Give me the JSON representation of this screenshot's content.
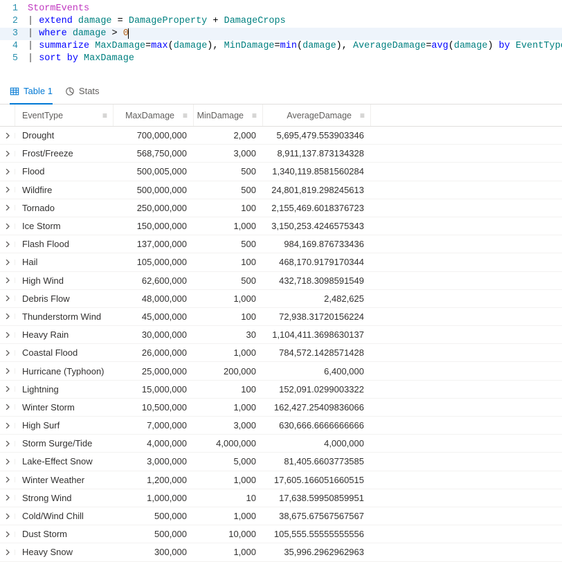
{
  "editor": {
    "lines": [
      {
        "n": "1",
        "active": false,
        "tokens": [
          {
            "cls": "tok-table",
            "t": "StormEvents"
          }
        ]
      },
      {
        "n": "2",
        "active": false,
        "tokens": [
          {
            "cls": "tok-pipe",
            "t": "| "
          },
          {
            "cls": "tok-keyword",
            "t": "extend"
          },
          {
            "cls": "",
            "t": " "
          },
          {
            "cls": "tok-ident",
            "t": "damage"
          },
          {
            "cls": "",
            "t": " "
          },
          {
            "cls": "tok-op",
            "t": "="
          },
          {
            "cls": "",
            "t": " "
          },
          {
            "cls": "tok-col",
            "t": "DamageProperty"
          },
          {
            "cls": "",
            "t": " "
          },
          {
            "cls": "tok-op",
            "t": "+"
          },
          {
            "cls": "",
            "t": " "
          },
          {
            "cls": "tok-col",
            "t": "DamageCrops"
          }
        ]
      },
      {
        "n": "3",
        "active": true,
        "tokens": [
          {
            "cls": "tok-pipe",
            "t": "| "
          },
          {
            "cls": "tok-keyword",
            "t": "where"
          },
          {
            "cls": "",
            "t": " "
          },
          {
            "cls": "tok-ident",
            "t": "damage"
          },
          {
            "cls": "",
            "t": " "
          },
          {
            "cls": "tok-op",
            "t": ">"
          },
          {
            "cls": "",
            "t": " "
          },
          {
            "cls": "tok-num",
            "t": "0"
          }
        ],
        "cursor": true
      },
      {
        "n": "4",
        "active": false,
        "tokens": [
          {
            "cls": "tok-pipe",
            "t": "| "
          },
          {
            "cls": "tok-keyword",
            "t": "summarize"
          },
          {
            "cls": "",
            "t": " "
          },
          {
            "cls": "tok-col",
            "t": "MaxDamage"
          },
          {
            "cls": "tok-op",
            "t": "="
          },
          {
            "cls": "tok-func",
            "t": "max"
          },
          {
            "cls": "tok-paren",
            "t": "("
          },
          {
            "cls": "tok-ident",
            "t": "damage"
          },
          {
            "cls": "tok-paren",
            "t": ")"
          },
          {
            "cls": "tok-op",
            "t": ", "
          },
          {
            "cls": "tok-col",
            "t": "MinDamage"
          },
          {
            "cls": "tok-op",
            "t": "="
          },
          {
            "cls": "tok-func",
            "t": "min"
          },
          {
            "cls": "tok-paren",
            "t": "("
          },
          {
            "cls": "tok-ident",
            "t": "damage"
          },
          {
            "cls": "tok-paren",
            "t": ")"
          },
          {
            "cls": "tok-op",
            "t": ", "
          },
          {
            "cls": "tok-col",
            "t": "AverageDamage"
          },
          {
            "cls": "tok-op",
            "t": "="
          },
          {
            "cls": "tok-func",
            "t": "avg"
          },
          {
            "cls": "tok-paren",
            "t": "("
          },
          {
            "cls": "tok-ident",
            "t": "damage"
          },
          {
            "cls": "tok-paren",
            "t": ")"
          },
          {
            "cls": "",
            "t": " "
          },
          {
            "cls": "tok-by",
            "t": "by"
          },
          {
            "cls": "",
            "t": " "
          },
          {
            "cls": "tok-col",
            "t": "EventType"
          }
        ]
      },
      {
        "n": "5",
        "active": false,
        "tokens": [
          {
            "cls": "tok-pipe",
            "t": "| "
          },
          {
            "cls": "tok-keyword",
            "t": "sort"
          },
          {
            "cls": "",
            "t": " "
          },
          {
            "cls": "tok-by",
            "t": "by"
          },
          {
            "cls": "",
            "t": " "
          },
          {
            "cls": "tok-col",
            "t": "MaxDamage"
          }
        ]
      }
    ]
  },
  "tabs": {
    "table": "Table 1",
    "stats": "Stats"
  },
  "columns": {
    "event": "EventType",
    "max": "MaxDamage",
    "min": "MinDamage",
    "avg": "AverageDamage"
  },
  "rows": [
    {
      "event": "Drought",
      "max": "700,000,000",
      "min": "2,000",
      "avg": "5,695,479.553903346"
    },
    {
      "event": "Frost/Freeze",
      "max": "568,750,000",
      "min": "3,000",
      "avg": "8,911,137.873134328"
    },
    {
      "event": "Flood",
      "max": "500,005,000",
      "min": "500",
      "avg": "1,340,119.8581560284"
    },
    {
      "event": "Wildfire",
      "max": "500,000,000",
      "min": "500",
      "avg": "24,801,819.298245613"
    },
    {
      "event": "Tornado",
      "max": "250,000,000",
      "min": "100",
      "avg": "2,155,469.6018376723"
    },
    {
      "event": "Ice Storm",
      "max": "150,000,000",
      "min": "1,000",
      "avg": "3,150,253.4246575343"
    },
    {
      "event": "Flash Flood",
      "max": "137,000,000",
      "min": "500",
      "avg": "984,169.876733436"
    },
    {
      "event": "Hail",
      "max": "105,000,000",
      "min": "100",
      "avg": "468,170.9179170344"
    },
    {
      "event": "High Wind",
      "max": "62,600,000",
      "min": "500",
      "avg": "432,718.3098591549"
    },
    {
      "event": "Debris Flow",
      "max": "48,000,000",
      "min": "1,000",
      "avg": "2,482,625"
    },
    {
      "event": "Thunderstorm Wind",
      "max": "45,000,000",
      "min": "100",
      "avg": "72,938.31720156224"
    },
    {
      "event": "Heavy Rain",
      "max": "30,000,000",
      "min": "30",
      "avg": "1,104,411.3698630137"
    },
    {
      "event": "Coastal Flood",
      "max": "26,000,000",
      "min": "1,000",
      "avg": "784,572.1428571428"
    },
    {
      "event": "Hurricane (Typhoon)",
      "max": "25,000,000",
      "min": "200,000",
      "avg": "6,400,000"
    },
    {
      "event": "Lightning",
      "max": "15,000,000",
      "min": "100",
      "avg": "152,091.0299003322"
    },
    {
      "event": "Winter Storm",
      "max": "10,500,000",
      "min": "1,000",
      "avg": "162,427.25409836066"
    },
    {
      "event": "High Surf",
      "max": "7,000,000",
      "min": "3,000",
      "avg": "630,666.6666666666"
    },
    {
      "event": "Storm Surge/Tide",
      "max": "4,000,000",
      "min": "4,000,000",
      "avg": "4,000,000"
    },
    {
      "event": "Lake-Effect Snow",
      "max": "3,000,000",
      "min": "5,000",
      "avg": "81,405.6603773585"
    },
    {
      "event": "Winter Weather",
      "max": "1,200,000",
      "min": "1,000",
      "avg": "17,605.166051660515"
    },
    {
      "event": "Strong Wind",
      "max": "1,000,000",
      "min": "10",
      "avg": "17,638.59950859951"
    },
    {
      "event": "Cold/Wind Chill",
      "max": "500,000",
      "min": "1,000",
      "avg": "38,675.67567567567"
    },
    {
      "event": "Dust Storm",
      "max": "500,000",
      "min": "10,000",
      "avg": "105,555.55555555556"
    },
    {
      "event": "Heavy Snow",
      "max": "300,000",
      "min": "1,000",
      "avg": "35,996.2962962963"
    }
  ]
}
